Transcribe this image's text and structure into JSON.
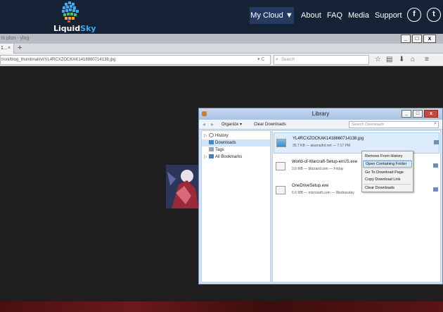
{
  "site": {
    "logo_word_1": "Liquid",
    "logo_word_2": "Sky",
    "nav": {
      "my_cloud": "My Cloud ▼",
      "about": "About",
      "faq": "FAQ",
      "media": "Media",
      "support": "Support"
    },
    "social": {
      "facebook_glyph": "f",
      "twitter_glyph": "t"
    }
  },
  "browser": {
    "window_title": "ls plon - ylog",
    "window_buttons": {
      "minimize": "_",
      "maximize": "□",
      "close": "x"
    },
    "tab_label": "1...",
    "tab_close": "×",
    "new_tab": "+",
    "url": "t/oni/blog_thumbnail/vl/YL4RCXZOCKAK1418860714138.jpg",
    "url_icons": "▾ C",
    "search_placeholder": "Search",
    "toolbar_icons": [
      "star-icon",
      "bookmarks-icon",
      "download-icon",
      "home-icon",
      "menu-icon"
    ]
  },
  "library": {
    "title": "Library",
    "window_buttons": {
      "minimize": "_",
      "maximize": "□",
      "close": "x"
    },
    "toolbar": {
      "back": "◂",
      "forward": "▸",
      "organize": "Organize ▾",
      "clear_downloads": "Clear Downloads",
      "search_placeholder": "Search Downloads"
    },
    "sidebar": [
      {
        "label": "History",
        "glyph": "▷",
        "selected": false
      },
      {
        "label": "Downloads",
        "glyph": "",
        "selected": true
      },
      {
        "label": "Tags",
        "glyph": "",
        "selected": false
      },
      {
        "label": "All Bookmarks",
        "glyph": "▷",
        "selected": false
      }
    ],
    "downloads": [
      {
        "name": "YL4RCXZOCKAK1418860714138.jpg",
        "meta": "35.7 KB — akamaihd.net — 7:17 PM",
        "selected": true
      },
      {
        "name": "World-of-Warcraft-Setup-enUS.exe",
        "meta": "2.6 MB — blizzard.com — Friday",
        "selected": false
      },
      {
        "name": "OneDriveSetup.exe",
        "meta": "6.6 MB — microsoft.com — Wednesday",
        "selected": false
      }
    ]
  },
  "context_menu": {
    "items": [
      {
        "label": "Remove From History",
        "highlighted": false
      },
      {
        "label": "Open Containing Folder",
        "highlighted": true
      },
      {
        "label": "Go To Download Page",
        "highlighted": false
      },
      {
        "label": "Copy Download Link",
        "highlighted": false
      },
      {
        "label": "Clear Downloads",
        "highlighted": false
      }
    ]
  },
  "colors": {
    "site_bar": "#162235",
    "accent": "#3fa9f5",
    "page_bg": "#1e1e1e",
    "library_frame": "#d9e4f1",
    "selection": "#dcecfc"
  }
}
